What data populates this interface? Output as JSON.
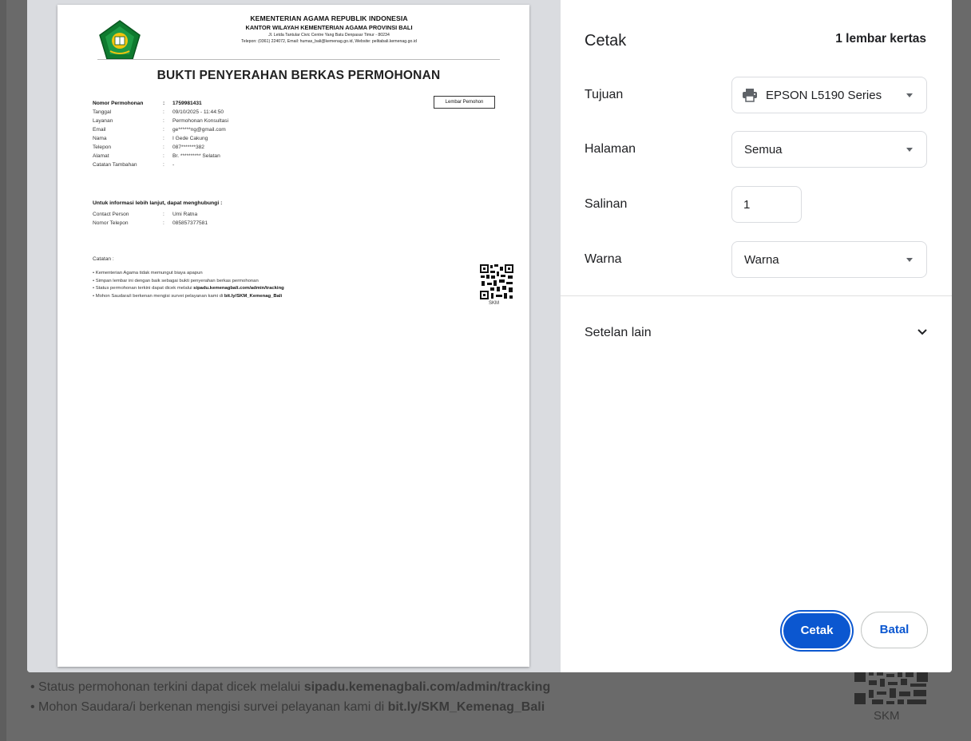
{
  "background": {
    "lines": [
      {
        "prefix": "Status permohonan terkini dapat dicek melalui ",
        "bold": "sipadu.kemenagbali.com/admin/tracking"
      },
      {
        "prefix": "Mohon Saudara/i berkenan mengisi survei pelayanan kami di ",
        "bold": "bit.ly/SKM_Kemenag_Bali"
      }
    ],
    "qr_label": "SKM"
  },
  "document": {
    "header": {
      "line1": "KEMENTERIAN AGAMA REPUBLIK INDONESIA",
      "line2": "KANTOR WILAYAH KEMENTERIAN AGAMA PROVINSI BALI",
      "line3": "Jl. Letda Tantular Civic Centre Yang Batu Denpasar Timur - 80234",
      "line4": "Telepon: (0361) 224072, Email: humas_bali@kemenag.go.id, Website: pelitabali.kemenag.go.id"
    },
    "title": "BUKTI PENYERAHAN BERKAS PERMOHONAN",
    "lembar_label": "Lembar Pemohon",
    "fields": [
      {
        "label": "Nomor Permohonan",
        "sep": ":",
        "value": "1759981431"
      },
      {
        "label": "Tanggal",
        "sep": ":",
        "value": "09/10/2025 - 11:44:50"
      },
      {
        "label": "Layanan",
        "sep": ":",
        "value": "Permohonan Konsultasi"
      },
      {
        "label": "Email",
        "sep": ":",
        "value": "ge******ng@gmail.com"
      },
      {
        "label": "Nama",
        "sep": ":",
        "value": "I Gede Cakung"
      },
      {
        "label": "Telepon",
        "sep": ":",
        "value": "087*******382"
      },
      {
        "label": "Alamat",
        "sep": ":",
        "value": "Br. ********** Selatan"
      },
      {
        "label": "Catatan Tambahan",
        "sep": ":",
        "value": "-"
      }
    ],
    "contact_heading": "Untuk informasi lebih lanjut, dapat menghubungi :",
    "contacts": [
      {
        "label": "Contact Person",
        "sep": ":",
        "value": "Umi Ratna"
      },
      {
        "label": "Nomor Telepon",
        "sep": ":",
        "value": "085857377581"
      }
    ],
    "notes_heading": "Catatan :",
    "notes": [
      {
        "prefix": "• Kementerian Agama tidak memungut biaya apapun",
        "bold": ""
      },
      {
        "prefix": "• Simpan lembar ini dengan baik sebagai bukti penyerahan berkas permohonan",
        "bold": ""
      },
      {
        "prefix": "• Status permohonan terkini dapat dicek melalui ",
        "bold": "sipadu.kemenagbali.com/admin/tracking"
      },
      {
        "prefix": "• Mohon Saudara/i berkenan mengisi survei pelayanan kami di ",
        "bold": "bit.ly/SKM_Kemenag_Bali"
      }
    ],
    "qr_label": "SKM"
  },
  "settings": {
    "title": "Cetak",
    "sheets": "1 lembar kertas",
    "destination_label": "Tujuan",
    "destination_value": "EPSON L5190 Series",
    "pages_label": "Halaman",
    "pages_value": "Semua",
    "copies_label": "Salinan",
    "copies_value": "1",
    "color_label": "Warna",
    "color_value": "Warna",
    "more_settings": "Setelan lain",
    "print_button": "Cetak",
    "cancel_button": "Batal"
  },
  "colors": {
    "accent": "#0b57d0",
    "overlay": "#5e5e5e"
  }
}
